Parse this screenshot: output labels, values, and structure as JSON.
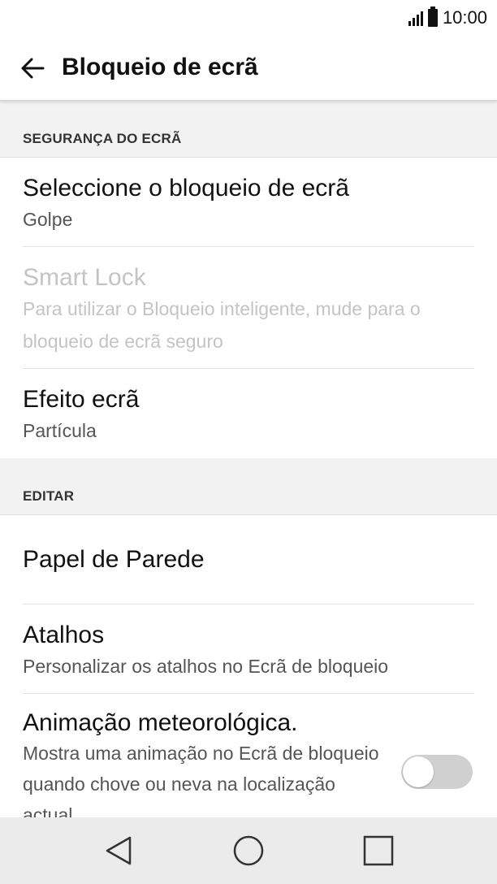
{
  "status_bar": {
    "time": "10:00",
    "signal_icon": "signal-icon",
    "battery_icon": "battery-icon"
  },
  "app_bar": {
    "title": "Bloqueio de ecrã",
    "back_icon": "back-arrow-icon"
  },
  "sections": [
    {
      "header": "SEGURANÇA DO ECRÃ"
    },
    {
      "header": "EDITAR"
    }
  ],
  "items": {
    "select_lock": {
      "title": "Seleccione o bloqueio de ecrã",
      "subtitle": "Golpe"
    },
    "smart_lock": {
      "title": "Smart Lock",
      "subtitle": "Para utilizar o Bloqueio inteligente, mude para o bloqueio de ecrã seguro",
      "enabled": false
    },
    "screen_effect": {
      "title": "Efeito ecrã",
      "subtitle": "Partícula"
    },
    "wallpaper": {
      "title": "Papel de Parede"
    },
    "shortcuts": {
      "title": "Atalhos",
      "subtitle": "Personalizar os atalhos no Ecrã de bloqueio"
    },
    "weather_animation": {
      "title": "Animação meteorológica.",
      "subtitle": "Mostra uma animação no Ecrã de bloqueio quando chove ou neva na localização actual.",
      "toggle_on": false
    }
  },
  "nav_bar": {
    "back_icon": "nav-back-icon",
    "home_icon": "nav-home-icon",
    "recents_icon": "nav-recents-icon"
  },
  "colors": {
    "disabled_text": "#c4c4c4",
    "section_bg": "#f2f2f2",
    "nav_bg": "#ebebeb",
    "toggle_off": "#d0d0d0"
  }
}
